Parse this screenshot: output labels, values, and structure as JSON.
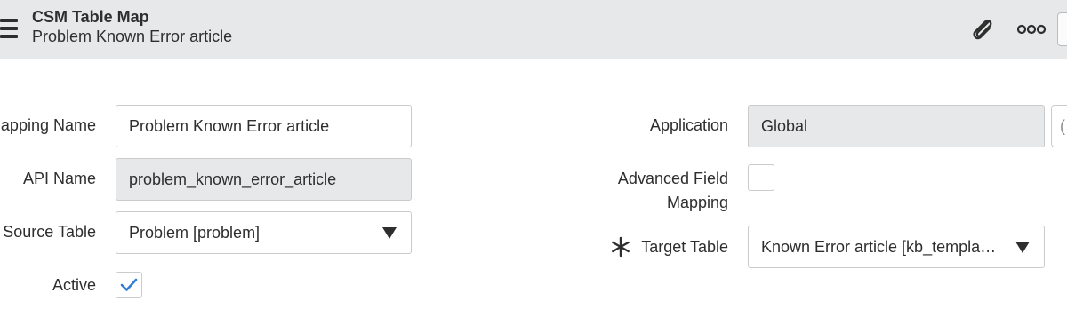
{
  "header": {
    "title": "CSM Table Map",
    "subtitle": "Problem Known Error article",
    "icons": {
      "menu": "hamburger-menu-icon",
      "attachment": "paperclip-icon",
      "more": "more-options-icon"
    }
  },
  "form": {
    "mapping_name": {
      "label": "apping Name",
      "value": "Problem Known Error article"
    },
    "api_name": {
      "label": "API Name",
      "value": "problem_known_error_article"
    },
    "source_table": {
      "label": "Source Table",
      "value": "Problem [problem]"
    },
    "active": {
      "label": "Active",
      "checked": true
    },
    "application": {
      "label": "Application",
      "value": "Global",
      "edge_char": "("
    },
    "advanced_field_mapping": {
      "label_line1": "Advanced Field",
      "label_line2": "Mapping",
      "checked": false
    },
    "target_table": {
      "label": "Target Table",
      "value": "Known Error article [kb_templa…",
      "required": true
    }
  },
  "colors": {
    "accent": "#2e7ed6",
    "header_bg": "#e7e8ea",
    "readonly_bg": "#e7e8ea",
    "border": "#c9cbcd"
  }
}
